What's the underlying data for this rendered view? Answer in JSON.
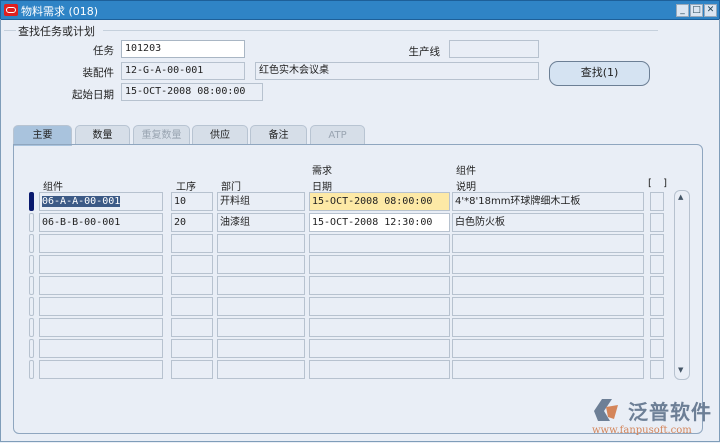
{
  "window": {
    "title": "物料需求 (018)",
    "minimize": "_",
    "maximize": "□",
    "close": "✕"
  },
  "search": {
    "section_title": "查找任务或计划",
    "task_label": "任务",
    "task_value": "101203",
    "assembly_label": "装配件",
    "assembly_value": "12-G-A-00-001",
    "assembly_desc": "红色实木会议桌",
    "start_label": "起始日期",
    "start_value": "15-OCT-2008 08:00:00",
    "line_label": "生产线",
    "line_value": "",
    "find_button": "查找(1)"
  },
  "tabs": [
    {
      "label": "主要",
      "active": true
    },
    {
      "label": "数量"
    },
    {
      "label": "重复数量",
      "disabled": true
    },
    {
      "label": "供应"
    },
    {
      "label": "备注"
    },
    {
      "label": "ATP",
      "disabled": true
    }
  ],
  "table": {
    "headers": {
      "component": "组件",
      "op": "工序",
      "dept": "部门",
      "date_top": "需求",
      "date": "日期",
      "desc_top": "组件",
      "desc": "说明",
      "flex": "[ ]"
    },
    "rows": [
      {
        "component": "06-A-A-00-001",
        "op": "10",
        "dept": "开料组",
        "date": "15-OCT-2008 08:00:00",
        "desc": "4'*8'18mm环球牌细木工板"
      },
      {
        "component": "06-B-B-00-001",
        "op": "20",
        "dept": "油漆组",
        "date": "15-OCT-2008 12:30:00",
        "desc": "白色防火板"
      },
      {},
      {},
      {},
      {},
      {},
      {},
      {}
    ]
  },
  "watermark": {
    "brand": "泛普软件",
    "url": "www.fanpusoft.com"
  },
  "colors": {
    "titlebar": "#2f84c6",
    "selected_field": "#fde9a6",
    "background": "#e9eef6"
  }
}
